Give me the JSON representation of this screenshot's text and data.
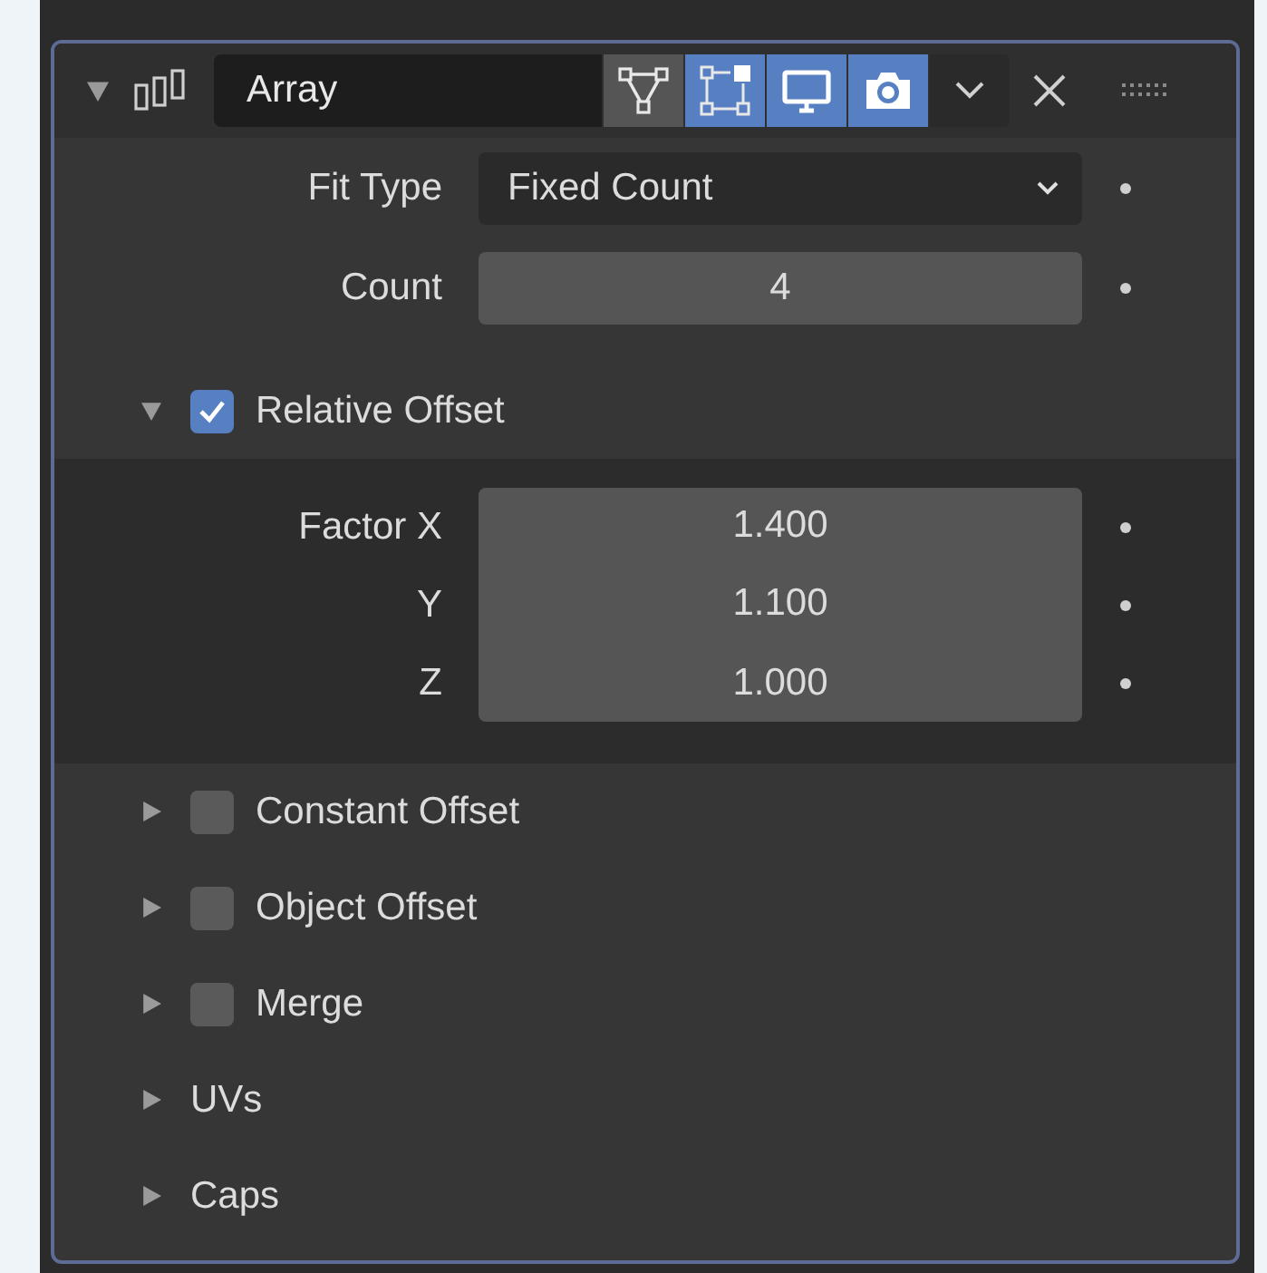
{
  "modifier": {
    "expanded": true,
    "name": "Array",
    "toggles": [
      {
        "kind": "edit_mode",
        "on": false
      },
      {
        "kind": "cage",
        "on": true
      },
      {
        "kind": "viewport",
        "on": true
      },
      {
        "kind": "render",
        "on": true
      }
    ]
  },
  "fields": [
    {
      "label": "Fit Type",
      "kind": "dropdown",
      "value": "Fixed Count"
    },
    {
      "label": "Count",
      "kind": "number",
      "value": "4"
    }
  ],
  "sections": [
    {
      "label": "Relative Offset",
      "kind": "checkbox",
      "expanded": true,
      "checked": true,
      "fields": [
        {
          "label": "Factor X",
          "value": "1.400"
        },
        {
          "label": "Y",
          "value": "1.100"
        },
        {
          "label": "Z",
          "value": "1.000"
        }
      ]
    },
    {
      "label": "Constant Offset",
      "kind": "checkbox",
      "expanded": false,
      "checked": false
    },
    {
      "label": "Object Offset",
      "kind": "checkbox",
      "expanded": false,
      "checked": false
    },
    {
      "label": "Merge",
      "kind": "checkbox",
      "expanded": false,
      "checked": false
    },
    {
      "label": "UVs",
      "kind": "plain",
      "expanded": false
    },
    {
      "label": "Caps",
      "kind": "plain",
      "expanded": false
    }
  ]
}
